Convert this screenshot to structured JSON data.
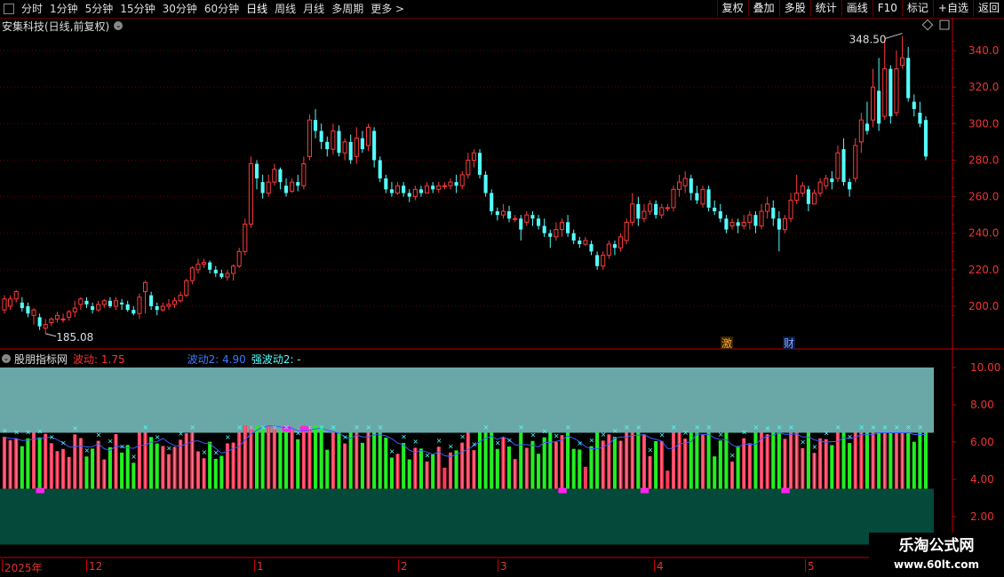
{
  "toolbar": {
    "periods": [
      "分时",
      "1分钟",
      "5分钟",
      "15分钟",
      "30分钟",
      "60分钟",
      "日线",
      "周线",
      "月线",
      "多周期",
      "更多 >"
    ],
    "active_period": "日线",
    "buttons": [
      "复权",
      "叠加",
      "多股",
      "统计",
      "画线",
      "F10",
      "标记",
      "+自选",
      "返回"
    ]
  },
  "main_chart": {
    "title": "安集科技(日线,前复权)",
    "dropdown_icon": "chevron-down-icon",
    "high_label": "348.50",
    "low_label": "185.08",
    "y_ticks": [
      "340.0",
      "320.0",
      "300.0",
      "280.0",
      "260.0",
      "240.0",
      "220.0",
      "200.0"
    ],
    "markers": [
      "激",
      "财"
    ],
    "colors": {
      "up": "#ff3b3b",
      "down": "#54fcfc",
      "axis": "#c00000",
      "grid": "#6a0000"
    }
  },
  "indicator": {
    "name": "股朋指标网",
    "fields": [
      {
        "label": "波动: 1.75",
        "color": "#ff3030"
      },
      {
        "label": "波动2: 4.90",
        "color": "#3a7bff"
      },
      {
        "label": "强波动2: -",
        "color": "#55ffff"
      }
    ],
    "y_ticks": [
      "10.00",
      "8.00",
      "6.00",
      "4.00",
      "2.00"
    ],
    "colors": {
      "upper_band": "#6aa8a8",
      "lower_band": "#04493a",
      "bar_up": "#ff3a5a",
      "bar_down": "#22ee22",
      "highlight": "#ff22ee",
      "line": "#3a5cff",
      "cross": "#55ffff"
    }
  },
  "x_axis": {
    "labels": [
      "2025年",
      "12",
      "1",
      "2",
      "3",
      "4",
      "5"
    ]
  },
  "watermark": {
    "line1": "乐淘公式网",
    "line2": "www.60lt.com"
  }
}
